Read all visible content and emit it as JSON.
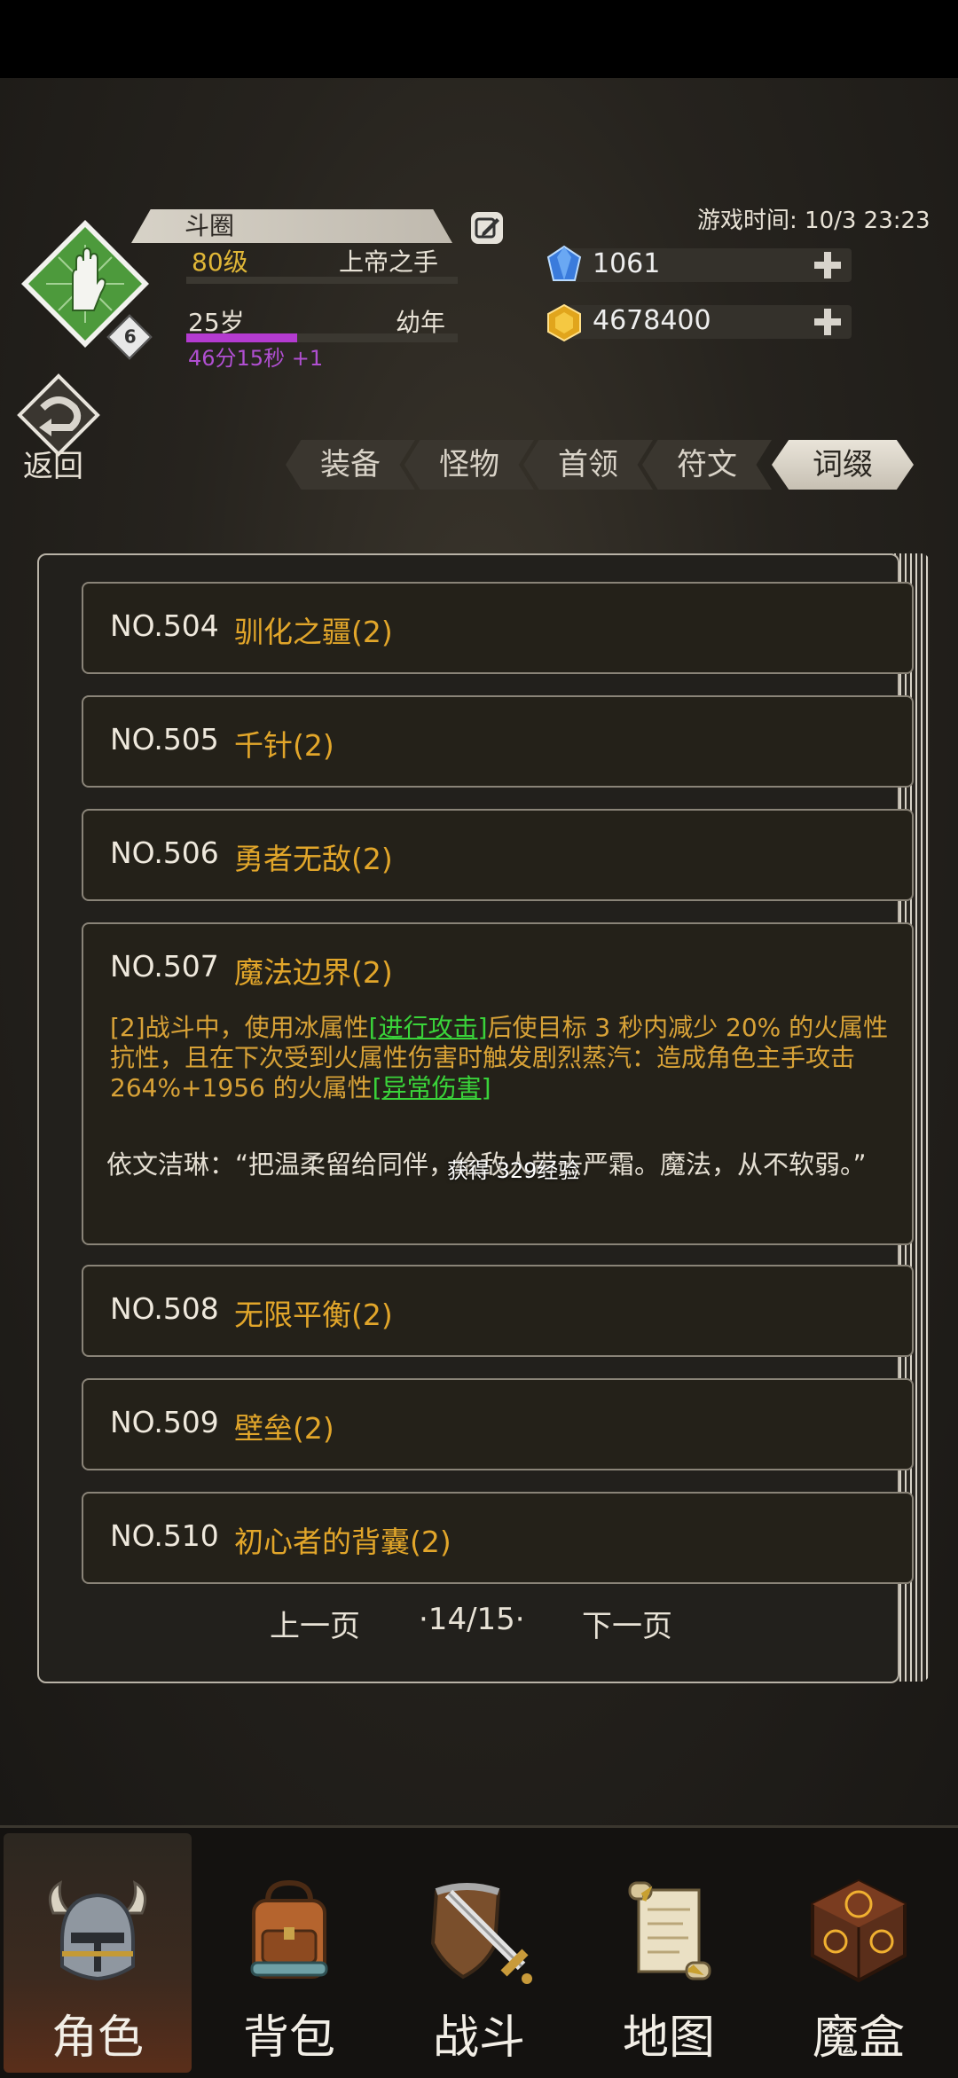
{
  "header": {
    "player_name": "斗圈",
    "level": "80级",
    "title": "上帝之手",
    "age": "25岁",
    "stage": "幼年",
    "timer": "46分15秒 +1",
    "timer_progress": 0.41,
    "avatar_badge": "6",
    "game_time": "游戏时间: 10/3 23:23"
  },
  "resources": {
    "gem": "1061",
    "gold": "4678400"
  },
  "back_label": "返回",
  "tabs": [
    {
      "label": "装备"
    },
    {
      "label": "怪物"
    },
    {
      "label": "首领"
    },
    {
      "label": "符文"
    },
    {
      "label": "词缀",
      "active": true
    }
  ],
  "entries": [
    {
      "no": "NO.504",
      "name": "驯化之疆(2)"
    },
    {
      "no": "NO.505",
      "name": "千针(2)"
    },
    {
      "no": "NO.506",
      "name": "勇者无敌(2)"
    },
    {
      "no": "NO.507",
      "name": "魔法边界(2)",
      "desc_1": "[2]战斗中，使用冰属性",
      "link_1": "[进行攻击]",
      "desc_2": "后使目标 3 秒内减少 20% 的火属性抗性，且在下次受到火属性伤害时触发剧烈蒸汽：造成角色主手攻击 264%+1956 的火属性",
      "link_2": "[异常伤害]",
      "lore": "依文洁琳：“把温柔留给同伴，给敌人带去严霜。魔法，从不软弱。”"
    },
    {
      "no": "NO.508",
      "name": "无限平衡(2)"
    },
    {
      "no": "NO.509",
      "name": "壁垒(2)"
    },
    {
      "no": "NO.510",
      "name": "初心者的背囊(2)"
    }
  ],
  "toast": "获得 329经验",
  "pager": {
    "prev": "上一页",
    "page": "·14/15·",
    "next": "下一页"
  },
  "nav": [
    {
      "label": "角色",
      "icon": "helmet-icon",
      "active": true
    },
    {
      "label": "背包",
      "icon": "backpack-icon"
    },
    {
      "label": "战斗",
      "icon": "sword-shield-icon"
    },
    {
      "label": "地图",
      "icon": "scroll-map-icon"
    },
    {
      "label": "魔盒",
      "icon": "magic-box-icon"
    }
  ]
}
